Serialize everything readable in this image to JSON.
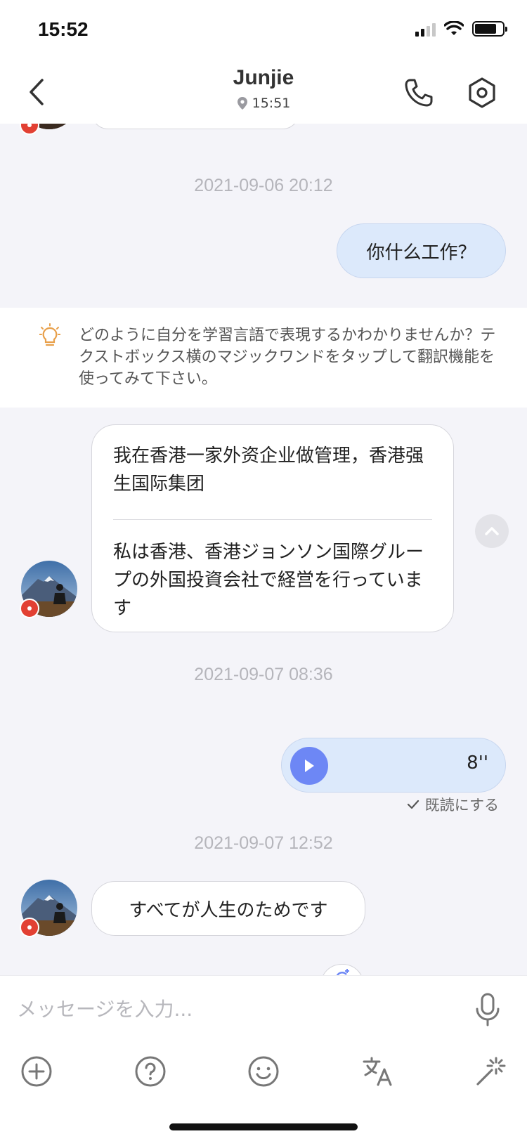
{
  "status_bar": {
    "time": "15:52"
  },
  "header": {
    "name": "Junjie",
    "local_time": "15:51"
  },
  "messages": [
    {
      "type": "timestamp",
      "text": "2021-09-06 20:12"
    },
    {
      "type": "outgoing",
      "text": "你什么工作？"
    },
    {
      "type": "tip",
      "text": "どのように自分を学習言語で表現するかわかりませんか？テクストボックス横のマジックワンドをタップして翻訳機能を使ってみて下さい。"
    },
    {
      "type": "incoming",
      "text": "我在香港一家外资企业做管理，香港强生国际集团",
      "translation": "私は香港、香港ジョンソン国際グループの外国投資会社で経営を行っています"
    },
    {
      "type": "timestamp",
      "text": "2021-09-07 08:36"
    },
    {
      "type": "voice",
      "duration": "8''",
      "read_label": "既読にする"
    },
    {
      "type": "timestamp",
      "text": "2021-09-07 12:52"
    },
    {
      "type": "incoming",
      "text": "すべてが人生のためです"
    }
  ],
  "composer": {
    "placeholder": "メッセージを入力..."
  },
  "colors": {
    "outgoing_bubble": "#dce9fb",
    "play_button": "#6d87f5",
    "tip_icon": "#e8a04b",
    "flag": "#e24033"
  },
  "icons": {
    "back": "chevron-left-icon",
    "call": "phone-icon",
    "settings": "hexagon-gear-icon",
    "location": "location-pin-icon",
    "tip": "lightbulb-icon",
    "scroll_up": "chevron-up-icon",
    "play": "play-icon",
    "check": "check-icon",
    "mic": "microphone-icon",
    "add": "plus-circle-icon",
    "help": "question-circle-icon",
    "emoji": "smiley-icon",
    "translate": "translate-icon",
    "magic": "magic-wand-icon"
  }
}
